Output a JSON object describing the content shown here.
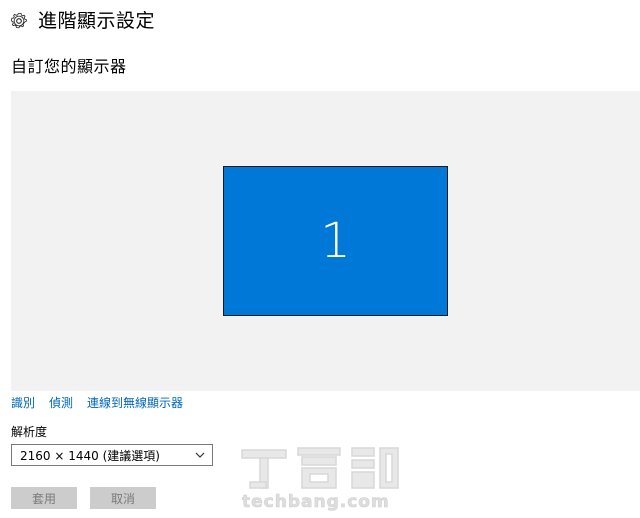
{
  "header": {
    "title": "進階顯示設定",
    "icon": "gear-icon"
  },
  "section": {
    "title": "自訂您的顯示器"
  },
  "canvas": {
    "monitor_number": "1",
    "monitor_color": "#0078d7",
    "background_color": "#f2f2f2"
  },
  "links": {
    "identify": "識別",
    "detect": "偵測",
    "connect_wireless": "連線到無線顯示器",
    "link_color": "#0067b8"
  },
  "resolution": {
    "label": "解析度",
    "selected": "2160 × 1440 (建議選項)"
  },
  "buttons": {
    "apply": "套用",
    "cancel": "取消"
  },
  "watermark": {
    "text": "techbang.com"
  }
}
